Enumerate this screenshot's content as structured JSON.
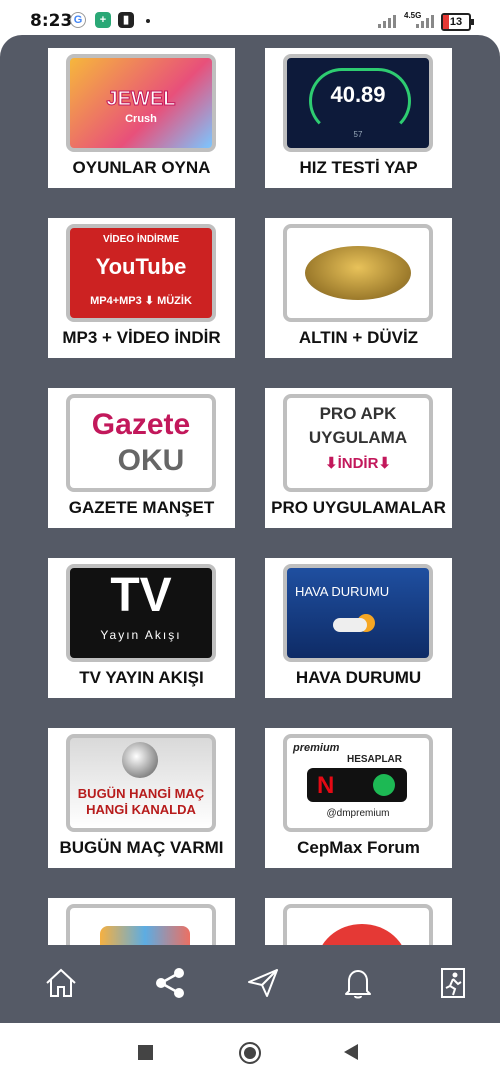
{
  "status_bar": {
    "time": "8:23",
    "network": "4.5G",
    "battery": "13"
  },
  "tiles": [
    {
      "label": "OYUNLAR OYNA",
      "thumb_text": [
        "JEWEL",
        "Crush"
      ]
    },
    {
      "label": "HIZ TESTİ YAP",
      "thumb_text": [
        "40.89",
        "57"
      ]
    },
    {
      "label": "MP3 + VİDEO İNDİR",
      "thumb_text": [
        "VİDEO İNDİRME",
        "YouTube",
        "MP4+MP3 ⬇ MÜZİK"
      ]
    },
    {
      "label": "ALTIN + DÜVİZ",
      "thumb_text": []
    },
    {
      "label": "GAZETE MANŞET",
      "thumb_text": [
        "Gazete",
        "OKU"
      ]
    },
    {
      "label": "PRO UYGULAMALAR",
      "thumb_text": [
        "PRO APK",
        "UYGULAMA",
        "⬇İNDİR⬇"
      ]
    },
    {
      "label": "TV YAYIN AKIŞI",
      "thumb_text": [
        "TV",
        "Yayın Akışı"
      ]
    },
    {
      "label": "HAVA DURUMU",
      "thumb_text": [
        "HAVA DURUMU"
      ]
    },
    {
      "label": "BUGÜN MAÇ VARMI",
      "thumb_text": [
        "BUGÜN HANGİ MAÇ",
        "HANGİ KANALDA"
      ]
    },
    {
      "label": "CepMax Forum",
      "thumb_text": [
        "premium",
        "HESAPLAR",
        "@dmpremium"
      ]
    }
  ],
  "bottom_nav": [
    {
      "icon": "home-icon"
    },
    {
      "icon": "share-icon"
    },
    {
      "icon": "send-icon"
    },
    {
      "icon": "bell-icon"
    },
    {
      "icon": "exit-icon"
    }
  ],
  "colors": {
    "panel_bg": "#555a66",
    "card_bg": "#ffffff",
    "label_text": "#111111"
  }
}
